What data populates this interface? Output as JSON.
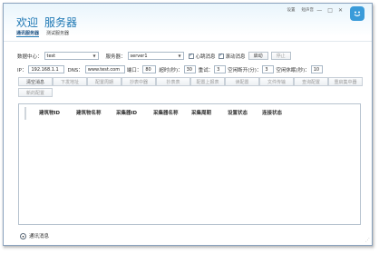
{
  "header": {
    "welcome": "欢迎",
    "title": "服务器",
    "tabs": [
      {
        "label": "通讯服务器",
        "active": true
      },
      {
        "label": "测试服务器",
        "active": false
      }
    ],
    "links": [
      "设置",
      "短声音"
    ],
    "window_controls": [
      "—",
      "□",
      "✕"
    ]
  },
  "connection": {
    "datacenter_label": "数据中心：",
    "datacenter_value": "test",
    "server_label": "服务器：",
    "server_value": "server1",
    "heartbeat_label": "心跳消息",
    "heartbeat_checked": true,
    "scroll_label": "滚动消息",
    "scroll_checked": true,
    "start_label": "启动",
    "stop_label": "停止"
  },
  "network": {
    "ip_label": "IP：",
    "ip_value": "192.168.1.1",
    "dns_label": "DNS：",
    "dns_value": "www.test.com",
    "port_label": "端口：",
    "port_value": "80",
    "timeout_label": "超时(秒)：",
    "timeout_value": "30",
    "retry_label": "重试：",
    "retry_value": "3",
    "idle_disconnect_label": "空闲断开(分)：",
    "idle_disconnect_value": "3",
    "idle_sleep_label": "空闲休眠(秒)：",
    "idle_sleep_value": "10"
  },
  "actions": {
    "row1": [
      "清空消息",
      "下发地址",
      "配置周期",
      "抄表中器",
      "抄表表",
      "配置上报表",
      "读配置",
      "文件传输",
      "查询配置",
      "重启集中器"
    ],
    "row1_enabled": [
      true,
      false,
      false,
      false,
      false,
      false,
      false,
      false,
      false,
      false
    ],
    "row2": [
      "新的配置"
    ]
  },
  "table": {
    "columns": [
      "建筑物ID",
      "建筑物名称",
      "采集器ID",
      "采集器名称",
      "采集周期",
      "设置状态",
      "连接状态"
    ]
  },
  "footer": {
    "label": "通讯消息"
  },
  "colors": {
    "accent": "#1f78b4",
    "logo": "#3a9bd9"
  }
}
